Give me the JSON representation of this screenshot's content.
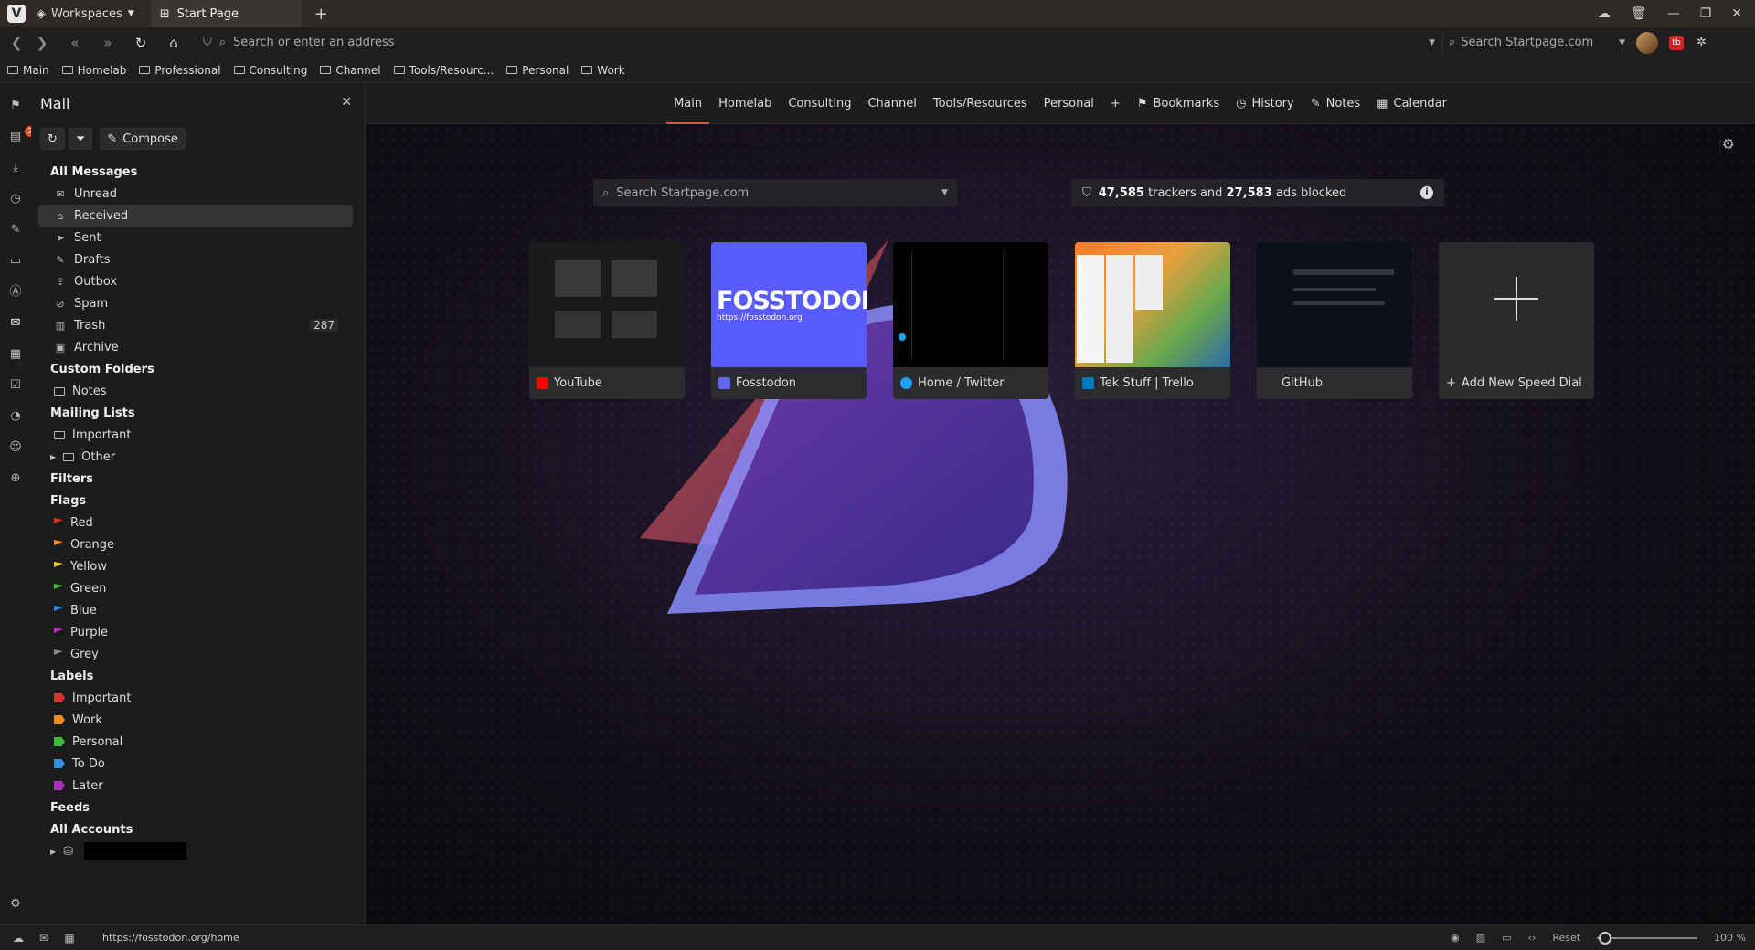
{
  "titlebar": {
    "workspaces_label": "Workspaces",
    "tab_title": "Start Page"
  },
  "address": {
    "placeholder": "Search or enter an address",
    "search_placeholder": "Search Startpage.com"
  },
  "bookmarks": [
    "Main",
    "Homelab",
    "Professional",
    "Consulting",
    "Channel",
    "Tools/Resourc...",
    "Personal",
    "Work"
  ],
  "mail": {
    "title": "Mail",
    "compose_label": "Compose",
    "all_messages": "All Messages",
    "folders": [
      {
        "label": "Unread",
        "icon": "envelope-open-icon"
      },
      {
        "label": "Received",
        "icon": "inbox-icon",
        "selected": true
      },
      {
        "label": "Sent",
        "icon": "send-icon"
      },
      {
        "label": "Drafts",
        "icon": "draft-icon"
      },
      {
        "label": "Outbox",
        "icon": "outbox-icon"
      },
      {
        "label": "Spam",
        "icon": "spam-icon"
      },
      {
        "label": "Trash",
        "icon": "trash-icon",
        "count": "287"
      },
      {
        "label": "Archive",
        "icon": "archive-icon"
      }
    ],
    "custom_folders": "Custom Folders",
    "custom_items": [
      "Notes"
    ],
    "mailing_lists": "Mailing Lists",
    "mailing_items": [
      "Important",
      "Other"
    ],
    "filters": "Filters",
    "flags_heading": "Flags",
    "flags": [
      {
        "label": "Red",
        "color": "#e0302a"
      },
      {
        "label": "Orange",
        "color": "#f08a24"
      },
      {
        "label": "Yellow",
        "color": "#f2d21b"
      },
      {
        "label": "Green",
        "color": "#3cba3c"
      },
      {
        "label": "Blue",
        "color": "#2f8fe0"
      },
      {
        "label": "Purple",
        "color": "#b02fc0"
      },
      {
        "label": "Grey",
        "color": "#888888"
      }
    ],
    "labels_heading": "Labels",
    "labels": [
      {
        "label": "Important",
        "color": "#e0302a"
      },
      {
        "label": "Work",
        "color": "#f08a24"
      },
      {
        "label": "Personal",
        "color": "#3cba3c"
      },
      {
        "label": "To Do",
        "color": "#2f8fe0"
      },
      {
        "label": "Later",
        "color": "#b02fc0"
      }
    ],
    "feeds": "Feeds",
    "all_accounts": "All Accounts"
  },
  "startpage": {
    "nav": [
      "Main",
      "Homelab",
      "Consulting",
      "Channel",
      "Tools/Resources",
      "Personal"
    ],
    "nav_extra": [
      "Bookmarks",
      "History",
      "Notes",
      "Calendar"
    ],
    "search_placeholder": "Search Startpage.com",
    "trackers_count": "47,585",
    "trackers_text": "trackers and",
    "ads_count": "27,583",
    "ads_text": "ads blocked",
    "speed_dials": [
      {
        "label": "YouTube",
        "favicon_color": "#ff0000"
      },
      {
        "label": "Fosstodon",
        "favicon_color": "#6364ff",
        "thumb_title": "FOSSTODON",
        "thumb_url": "https://fosstodon.org"
      },
      {
        "label": "Home / Twitter",
        "favicon_color": "#1da1f2"
      },
      {
        "label": "Tek Stuff | Trello",
        "favicon_color": "#0079bf"
      },
      {
        "label": "GitHub",
        "favicon_color": "#ffffff"
      }
    ],
    "add_dial_label": "Add New Speed Dial"
  },
  "status": {
    "url": "https://fosstodon.org/home",
    "reset_label": "Reset",
    "zoom": "100 %"
  },
  "colors": {
    "accent": "#e0582a"
  }
}
